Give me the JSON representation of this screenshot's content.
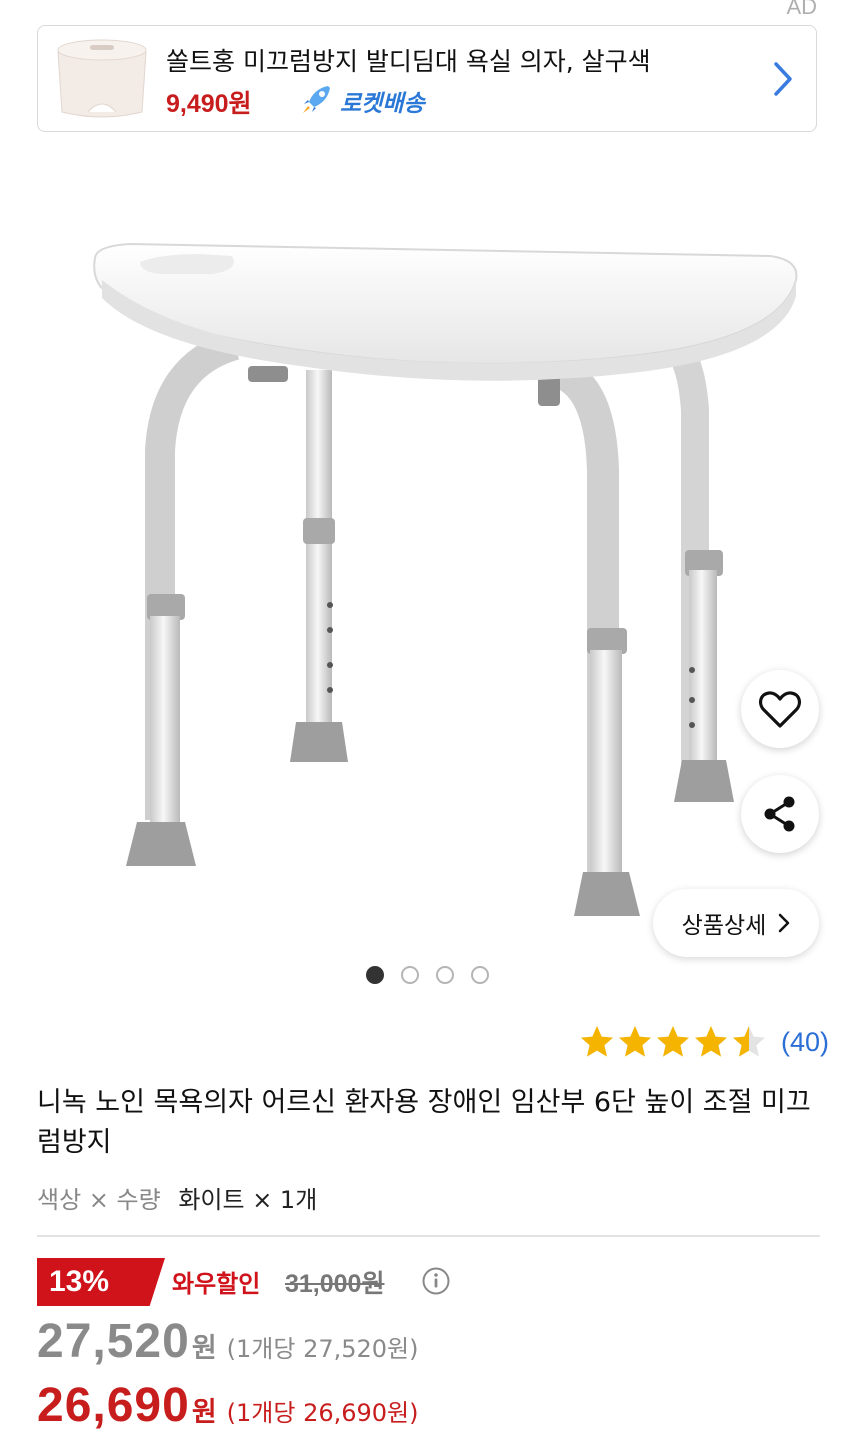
{
  "ad": {
    "label": "AD",
    "title": "쏠트홍 미끄럼방지 발디딤대 욕실 의자, 살구색",
    "price": "9,490원",
    "delivery": "로켓배송"
  },
  "image_carousel": {
    "total": 4,
    "active_index": 0
  },
  "detail_button": {
    "label": "상품상세"
  },
  "rating": {
    "value": 4.5,
    "review_count": "(40)"
  },
  "product": {
    "title": "니녹 노인 목욕의자 어르신 환자용 장애인 임산부 6단 높이 조절 미끄럼방지",
    "options_label": "색상 × 수량",
    "options_value": "화이트 × 1개"
  },
  "pricing": {
    "discount_rate": "13%",
    "discount_label": "와우할인",
    "original_price": "31,000원",
    "sale_price": "27,520",
    "sale_unit": "원",
    "sale_unit_price": "(1개당 27,520원)",
    "wow_price": "26,690",
    "wow_unit": "원",
    "wow_unit_price": "(1개당 26,690원)"
  },
  "colors": {
    "accent_red": "#c81d1d",
    "rocket_blue": "#2b78d6",
    "star_yellow": "#f5b400",
    "review_blue": "#2b6fd6"
  }
}
